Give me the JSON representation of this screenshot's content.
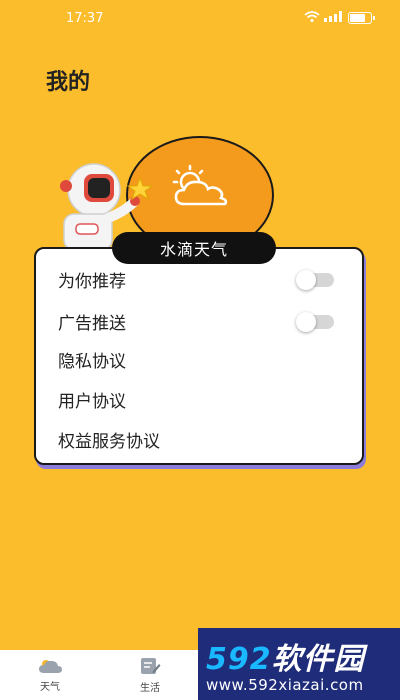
{
  "status_bar": {
    "time": "17:37"
  },
  "page": {
    "title": "我的"
  },
  "app": {
    "name": "水滴天气"
  },
  "menu": {
    "items": [
      {
        "label": "为你推荐",
        "toggle": "off"
      },
      {
        "label": "广告推送",
        "toggle": "off"
      },
      {
        "label": "隐私协议"
      },
      {
        "label": "用户协议"
      },
      {
        "label": "权益服务协议"
      }
    ]
  },
  "tabbar": {
    "tabs": [
      {
        "label": "天气",
        "icon": "cloud-icon"
      },
      {
        "label": "生活",
        "icon": "note-edit-icon"
      }
    ]
  },
  "watermark": {
    "logo_num": "592",
    "logo_text": "软件园",
    "url": "www.592xiazai.com"
  },
  "colors": {
    "background": "#FCBD2C",
    "bubble": "#F49A1C",
    "accent_shadow": "#8C7CDB"
  }
}
